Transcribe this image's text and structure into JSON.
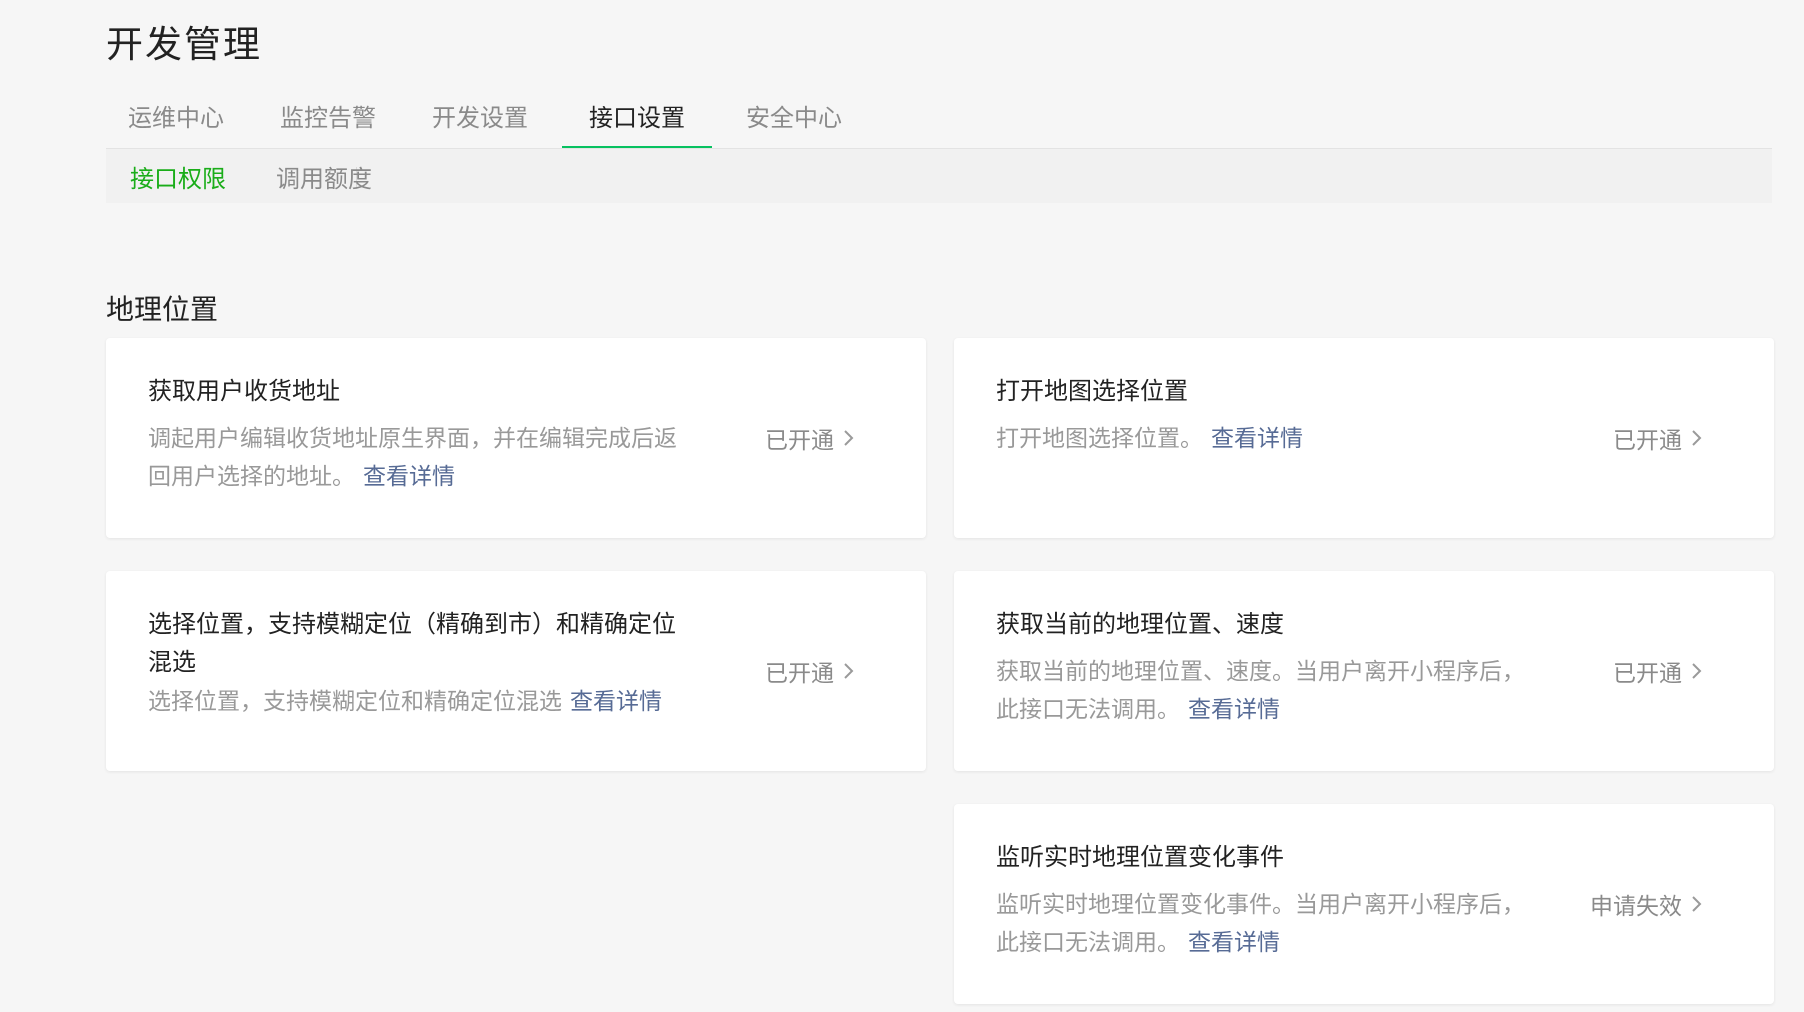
{
  "page": {
    "title": "开发管理"
  },
  "tabs": [
    {
      "label": "运维中心"
    },
    {
      "label": "监控告警"
    },
    {
      "label": "开发设置"
    },
    {
      "label": "接口设置",
      "active": true
    },
    {
      "label": "安全中心"
    }
  ],
  "subnav": [
    {
      "label": "接口权限",
      "active": true
    },
    {
      "label": "调用额度"
    }
  ],
  "section": {
    "title": "地理位置"
  },
  "colors": {
    "accent_green": "#07c160",
    "subnav_active": "#1aad19",
    "link": "#576b95",
    "muted": "#999999"
  },
  "cards": [
    {
      "title": "获取用户收货地址",
      "desc": "调起用户编辑收货地址原生界面，并在编辑完成后返回用户选择的地址。",
      "link": "查看详情",
      "status": "已开通"
    },
    {
      "title": "打开地图选择位置",
      "desc": "打开地图选择位置。",
      "link": "查看详情",
      "status": "已开通"
    },
    {
      "title": "选择位置，支持模糊定位（精确到市）和精确定位混选",
      "desc": "选择位置，支持模糊定位和精确定位混选",
      "link": "查看详情",
      "status": "已开通"
    },
    {
      "title": "获取当前的地理位置、速度",
      "desc": "获取当前的地理位置、速度。当用户离开小程序后，此接口无法调用。",
      "link": "查看详情",
      "status": "已开通"
    },
    {
      "title": "监听实时地理位置变化事件",
      "desc": "监听实时地理位置变化事件。当用户离开小程序后，此接口无法调用。",
      "link": "查看详情",
      "status": "申请失效"
    }
  ]
}
